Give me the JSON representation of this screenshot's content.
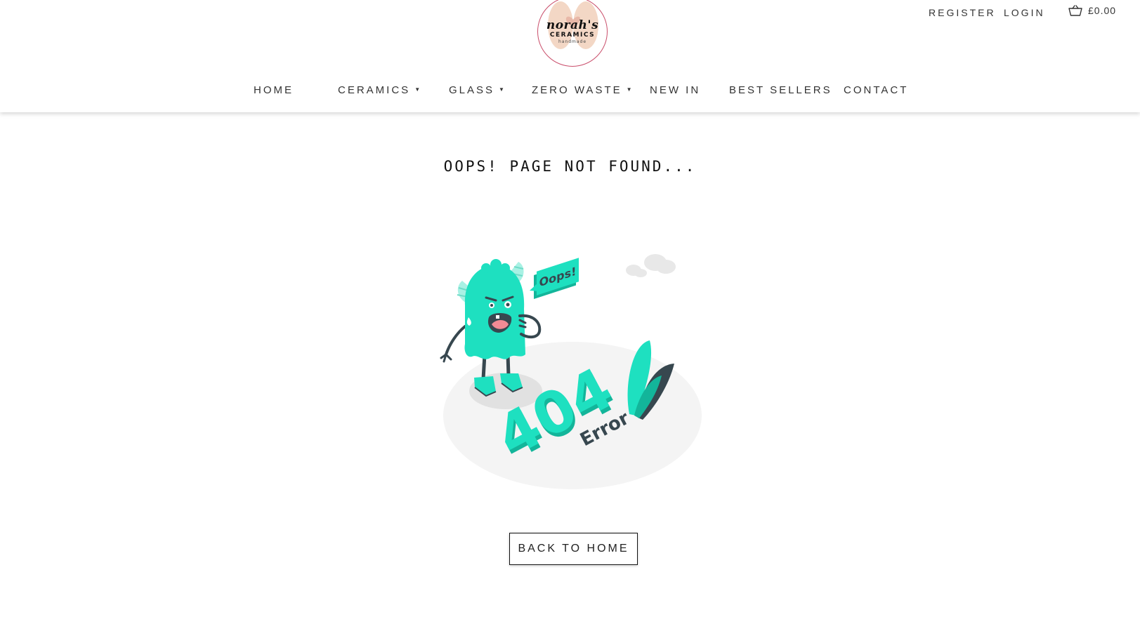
{
  "logo": {
    "line1": "norah's",
    "line2": "CERAMICS",
    "line3": "handmade"
  },
  "account": {
    "register_label": "REGISTER",
    "login_label": "LOGIN"
  },
  "cart": {
    "icon": "basket-icon",
    "amount": "£0.00"
  },
  "nav": {
    "items": [
      {
        "label": "HOME",
        "has_dropdown": false
      },
      {
        "label": "CERAMICS",
        "has_dropdown": true
      },
      {
        "label": "GLASS",
        "has_dropdown": true
      },
      {
        "label": "ZERO WASTE",
        "has_dropdown": true
      },
      {
        "label": "NEW IN",
        "has_dropdown": false
      },
      {
        "label": "BEST SELLERS",
        "has_dropdown": false
      },
      {
        "label": "CONTACT",
        "has_dropdown": false
      }
    ]
  },
  "main": {
    "title": "OOPS! PAGE NOT FOUND...",
    "illustration": {
      "speech_text": "Oops!",
      "big_text": "404",
      "sub_text": "Error"
    },
    "back_button_label": "BACK TO HOME"
  },
  "colors": {
    "accent": "#1ee0c0",
    "accent_dark": "#13b59a",
    "logo_border": "#c94d6a",
    "text": "#333333"
  }
}
